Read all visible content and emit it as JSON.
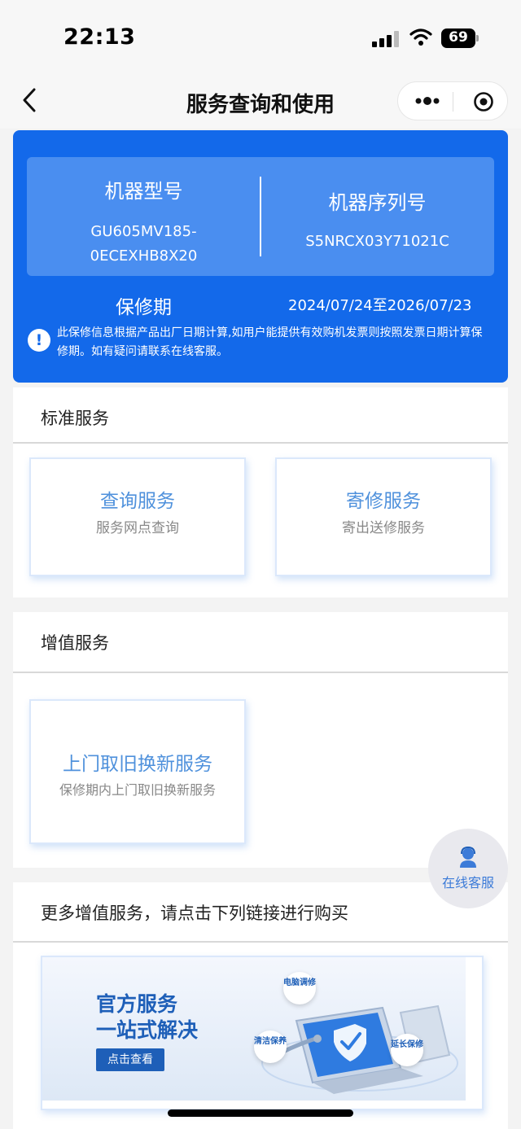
{
  "status_bar": {
    "time": "22:13",
    "battery": "69"
  },
  "nav": {
    "title": "服务查询和使用"
  },
  "device": {
    "model_label": "机器型号",
    "model_line1": "GU605MV185-",
    "model_line2": "0ECEXHB8X20",
    "serial_label": "机器序列号",
    "serial_value": "S5NRCX03Y71021C",
    "warranty_label": "保修期",
    "warranty_value": "2024/07/24至2026/07/23",
    "notice_icon": "!",
    "notice": "此保修信息根据产品出厂日期计算,如用户能提供有效购机发票则按照发票日期计算保修期。如有疑问请联系在线客服。"
  },
  "standard_services": {
    "title": "标准服务",
    "items": [
      {
        "title": "查询服务",
        "subtitle": "服务网点查询"
      },
      {
        "title": "寄修服务",
        "subtitle": "寄出送修服务"
      }
    ]
  },
  "value_added_services": {
    "title": "增值服务",
    "items": [
      {
        "title": "上门取旧换新服务",
        "subtitle": "保修期内上门取旧换新服务"
      }
    ]
  },
  "more_services": {
    "title": "更多增值服务，请点击下列链接进行购买",
    "banner": {
      "line1": "官方服务",
      "line2": "一站式解决",
      "button": "点击查看",
      "tags": [
        {
          "label": "电脑调修"
        },
        {
          "label": "清洁保养"
        },
        {
          "label": "延长保修"
        }
      ]
    }
  },
  "floating": {
    "label": "在线客服"
  },
  "colors": {
    "primary": "#1369ea",
    "card_title": "#4f91dc",
    "banner_blue": "#1e5fb8"
  }
}
